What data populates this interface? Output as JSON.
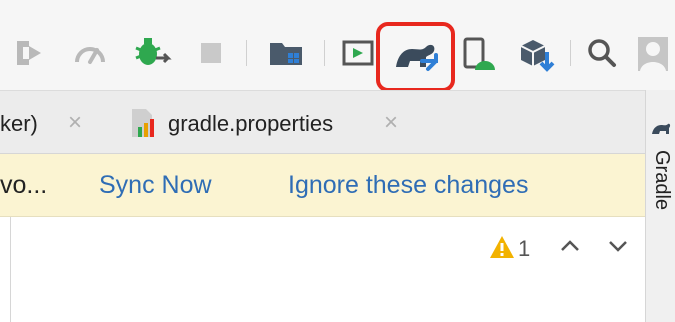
{
  "tabs": {
    "partial_label": "ker)",
    "partial_close": "×",
    "active_label": "gradle.properties",
    "active_close": "×"
  },
  "banner": {
    "truncated_message": "vo...",
    "sync_now": "Sync Now",
    "ignore_changes": "Ignore these changes"
  },
  "editor": {
    "warning_count": "1",
    "prev_symbol": "^",
    "next_symbol": "v"
  },
  "rightbar": {
    "label": "Gradle"
  },
  "colors": {
    "highlight": "#e8281e",
    "link": "#2f6db5",
    "banner_bg": "#fbf4d2",
    "warning": "#f2b200"
  }
}
